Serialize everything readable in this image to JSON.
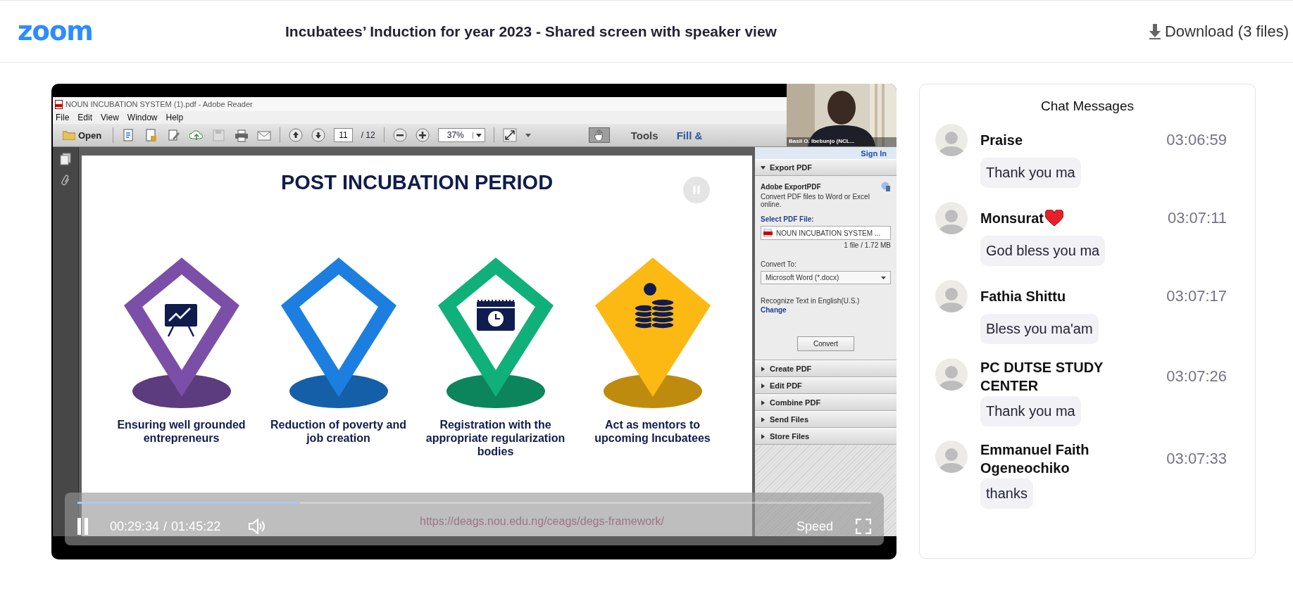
{
  "header": {
    "logo": "zoom",
    "title": "Incubatees’ Induction for year 2023 - Shared screen with speaker view",
    "download": "Download (3 files)"
  },
  "player": {
    "shared_screen": {
      "app_title": "NOUN INCUBATION SYSTEM  (1).pdf - Adobe Reader",
      "menu": [
        "File",
        "Edit",
        "View",
        "Window",
        "Help"
      ],
      "toolbar": {
        "open": "Open",
        "page": "11",
        "page_total": "/ 12",
        "zoom": "37%",
        "tools": "Tools",
        "fill": "Fill &"
      },
      "speaker": {
        "name": "Basil O. Ibebunjo (NCL..."
      },
      "side_panel": {
        "sign_in": "Sign In",
        "export": {
          "heading": "Adobe ExportPDF",
          "description": "Convert PDF files to Word or Excel online.",
          "select_label": "Select PDF File:",
          "file": "NOUN INCUBATION SYSTEM  ...",
          "file_info": "1 file / 1.72 MB",
          "convert_label": "Convert To:",
          "convert_value": "Microsoft Word (*.docx)",
          "recognize": "Recognize Text in English(U.S.)",
          "change": "Change",
          "button": "Convert"
        },
        "sections": [
          {
            "label": "Export PDF",
            "expanded": true
          },
          {
            "label": "Create PDF",
            "expanded": false
          },
          {
            "label": "Edit PDF",
            "expanded": false
          },
          {
            "label": "Combine PDF",
            "expanded": false
          },
          {
            "label": "Send Files",
            "expanded": false
          },
          {
            "label": "Store Files",
            "expanded": false
          }
        ]
      },
      "slide": {
        "title": "POST INCUBATION PERIOD",
        "footer_link": "https://deags.nou.edu.ng/ceags/degs-framework/",
        "items": [
          {
            "caption": "Ensuring well grounded entrepreneurs",
            "color": "#7b4fa8",
            "kind": "outline"
          },
          {
            "caption": "Reduction of poverty and job creation",
            "color": "#1c7fe0",
            "kind": "outline"
          },
          {
            "caption": "Registration with the appropriate regularization bodies",
            "color": "#10b07a",
            "kind": "outline"
          },
          {
            "caption": "Act as mentors to upcoming Incubatees",
            "color": "#fdb913",
            "kind": "filled"
          }
        ]
      }
    },
    "controls": {
      "playing": true,
      "level": 0.28,
      "current": "00:29:34",
      "separator": "/",
      "duration": "01:45:22",
      "speed": "Speed"
    }
  },
  "chat": {
    "title": "Chat Messages",
    "messages": [
      {
        "sender": "Praise",
        "heart": false,
        "time": "03:06:59",
        "text": "Thank you ma"
      },
      {
        "sender": "Monsurat",
        "heart": true,
        "time": "03:07:11",
        "text": "God bless you ma"
      },
      {
        "sender": "Fathia Shittu",
        "heart": false,
        "time": "03:07:17",
        "text": "Bless you ma'am"
      },
      {
        "sender": "PC DUTSE STUDY CENTER",
        "heart": false,
        "time": "03:07:26",
        "text": "Thank you ma"
      },
      {
        "sender": "Emmanuel Faith Ogeneochiko",
        "heart": false,
        "time": "03:07:33",
        "text": "thanks"
      }
    ]
  }
}
